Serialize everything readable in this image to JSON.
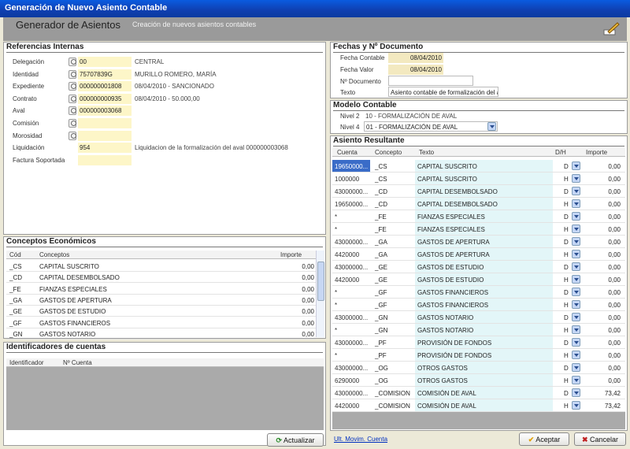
{
  "window": {
    "title": "Generación de Nuevo Asiento Contable"
  },
  "header": {
    "title": "Generador de Asientos",
    "subtitle": "Creación de nuevos asientos contables"
  },
  "referencias": {
    "title": "Referencias Internas",
    "fields": [
      {
        "label": "Delegación",
        "value": "00",
        "info": "CENTRAL"
      },
      {
        "label": "Identidad",
        "value": "75707839G",
        "info": "MURILLO ROMERO, MARÍA"
      },
      {
        "label": "Expediente",
        "value": "000000001808",
        "info": "08/04/2010 - SANCIONADO"
      },
      {
        "label": "Contrato",
        "value": "000000000935",
        "info": "08/04/2010 - 50.000,00"
      },
      {
        "label": "Aval",
        "value": "000000003068",
        "info": ""
      },
      {
        "label": "Comisión",
        "value": "",
        "info": ""
      },
      {
        "label": "Morosidad",
        "value": "",
        "info": ""
      },
      {
        "label": "Liquidación",
        "value": "954",
        "info": "Liquidacion de la formalización del aval 000000003068"
      },
      {
        "label": "Factura Soportada",
        "value": "",
        "info": ""
      }
    ]
  },
  "conceptos": {
    "title": "Conceptos Económicos",
    "headers": [
      "Cód",
      "Conceptos",
      "Importe"
    ],
    "rows": [
      [
        "_CS",
        "CAPITAL SUSCRITO",
        "0,00"
      ],
      [
        "_CD",
        "CAPITAL DESEMBOLSADO",
        "0,00"
      ],
      [
        "_FE",
        "FIANZAS ESPECIALES",
        "0,00"
      ],
      [
        "_GA",
        "GASTOS DE APERTURA",
        "0,00"
      ],
      [
        "_GE",
        "GASTOS DE ESTUDIO",
        "0,00"
      ],
      [
        "_GF",
        "GASTOS FINANCIEROS",
        "0,00"
      ],
      [
        "_GN",
        "GASTOS NOTARIO",
        "0,00"
      ]
    ]
  },
  "identificadores": {
    "title": "Identificadores de cuentas",
    "headers": [
      "Identificador",
      "Nº Cuenta"
    ],
    "button": "Actualizar"
  },
  "fechas": {
    "title": "Fechas y Nº Documento",
    "fecha_contable_label": "Fecha Contable",
    "fecha_contable": "08/04/2010",
    "fecha_valor_label": "Fecha Valor",
    "fecha_valor": "08/04/2010",
    "documento_label": "Nº Documento",
    "documento": "",
    "texto_label": "Texto",
    "texto": "Asiento contable de formalización del a"
  },
  "modelo": {
    "title": "Modelo Contable",
    "nivel2_label": "Nivel 2",
    "nivel2": "10 - FORMALIZACIÓN DE AVAL",
    "nivel4_label": "Nivel 4",
    "nivel4": "01 - FORMALIZACIÓN DE AVAL"
  },
  "asiento": {
    "title": "Asiento Resultante",
    "headers": [
      "Cuenta",
      "Concepto",
      "Texto",
      "D/H",
      "Importe"
    ],
    "rows": [
      [
        "19650000...",
        "_CS",
        "CAPITAL SUSCRITO",
        "D",
        "0,00"
      ],
      [
        "1000000",
        "_CS",
        "CAPITAL SUSCRITO",
        "H",
        "0,00"
      ],
      [
        "43000000...",
        "_CD",
        "CAPITAL DESEMBOLSADO",
        "D",
        "0,00"
      ],
      [
        "19650000...",
        "_CD",
        "CAPITAL DESEMBOLSADO",
        "H",
        "0,00"
      ],
      [
        "*",
        "_FE",
        "FIANZAS ESPECIALES",
        "D",
        "0,00"
      ],
      [
        "*",
        "_FE",
        "FIANZAS ESPECIALES",
        "H",
        "0,00"
      ],
      [
        "43000000...",
        "_GA",
        "GASTOS DE APERTURA",
        "D",
        "0,00"
      ],
      [
        "4420000",
        "_GA",
        "GASTOS DE APERTURA",
        "H",
        "0,00"
      ],
      [
        "43000000...",
        "_GE",
        "GASTOS DE ESTUDIO",
        "D",
        "0,00"
      ],
      [
        "4420000",
        "_GE",
        "GASTOS DE ESTUDIO",
        "H",
        "0,00"
      ],
      [
        "*",
        "_GF",
        "GASTOS FINANCIEROS",
        "D",
        "0,00"
      ],
      [
        "*",
        "_GF",
        "GASTOS FINANCIEROS",
        "H",
        "0,00"
      ],
      [
        "43000000...",
        "_GN",
        "GASTOS NOTARIO",
        "D",
        "0,00"
      ],
      [
        "*",
        "_GN",
        "GASTOS NOTARIO",
        "H",
        "0,00"
      ],
      [
        "43000000...",
        "_PF",
        "PROVISIÓN DE FONDOS",
        "D",
        "0,00"
      ],
      [
        "*",
        "_PF",
        "PROVISIÓN DE FONDOS",
        "H",
        "0,00"
      ],
      [
        "43000000...",
        "_OG",
        "OTROS GASTOS",
        "D",
        "0,00"
      ],
      [
        "6290000",
        "_OG",
        "OTROS GASTOS",
        "H",
        "0,00"
      ],
      [
        "43000000...",
        "_COMISION",
        "COMISIÓN DE AVAL",
        "D",
        "73,42"
      ],
      [
        "4420000",
        "_COMISION",
        "COMISIÓN DE AVAL",
        "H",
        "73,42"
      ]
    ]
  },
  "footer": {
    "link": "Ult. Movim. Cuenta",
    "accept": "Aceptar",
    "cancel": "Cancelar"
  }
}
